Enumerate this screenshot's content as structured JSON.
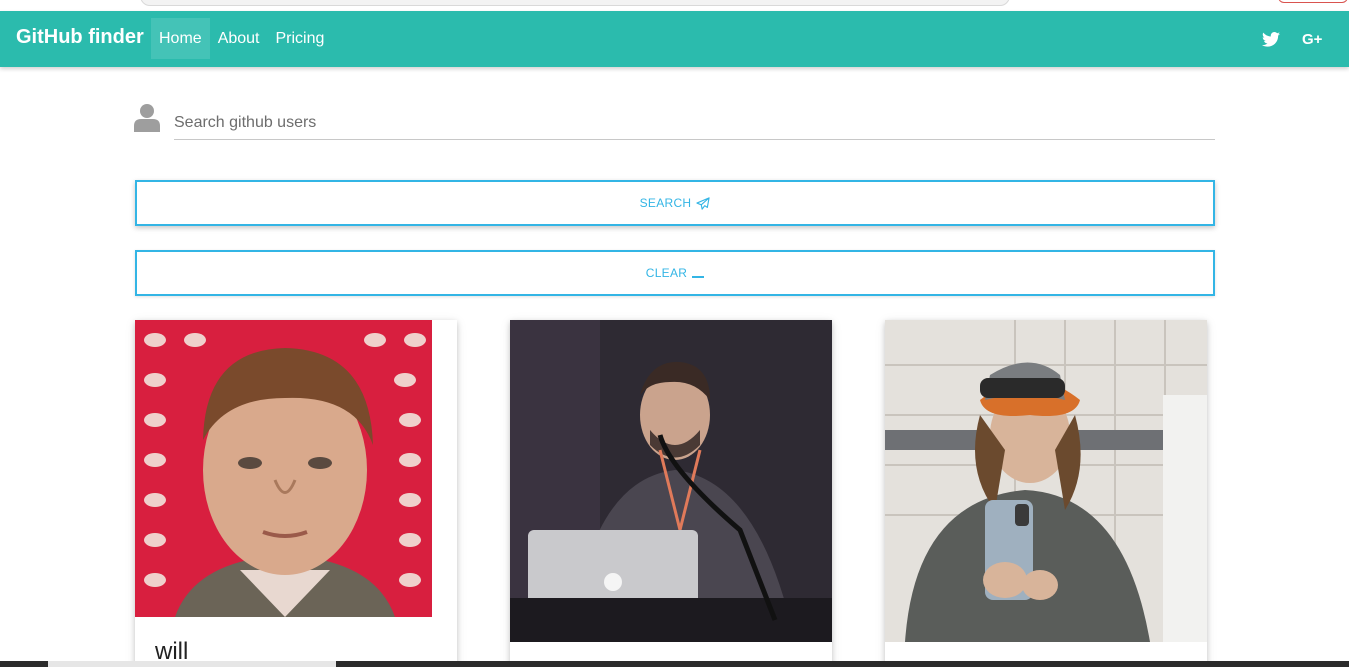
{
  "navbar": {
    "brand": "GitHub finder",
    "links": [
      {
        "label": "Home",
        "active": true
      },
      {
        "label": "About",
        "active": false
      },
      {
        "label": "Pricing",
        "active": false
      }
    ],
    "social": [
      {
        "icon": "twitter-icon"
      },
      {
        "icon": "google-plus-icon",
        "text": "G+"
      }
    ],
    "color": "#2bbbad"
  },
  "search": {
    "placeholder": "Search github users",
    "value": "",
    "icon": "user-icon"
  },
  "buttons": {
    "search_label": "SEARCH",
    "search_icon": "paper-plane-icon",
    "clear_label": "CLEAR",
    "clear_icon": "minus-icon",
    "accent": "#33b5e5"
  },
  "users": [
    {
      "name": "will",
      "avatar": "avatar-photo"
    },
    {
      "name": "",
      "avatar": "avatar-photo"
    },
    {
      "name": "",
      "avatar": "avatar-photo"
    }
  ]
}
